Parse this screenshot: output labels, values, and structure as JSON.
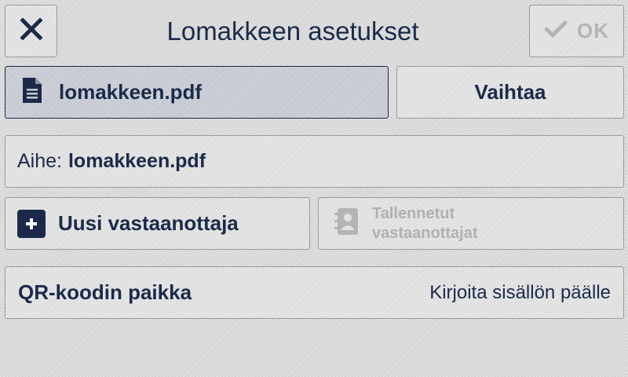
{
  "header": {
    "title": "Lomakkeen asetukset",
    "close_icon": "close-icon",
    "ok_label": "OK",
    "ok_icon": "checkmark-icon"
  },
  "file": {
    "name": "lomakkeen.pdf",
    "icon": "document-icon",
    "change_label": "Vaihtaa"
  },
  "subject": {
    "label": "Aihe:",
    "value": "lomakkeen.pdf"
  },
  "recipients": {
    "new_label": "Uusi vastaanottaja",
    "new_icon": "plus-icon",
    "saved_label": "Tallennetut vastaanottajat",
    "saved_icon": "address-book-icon"
  },
  "qr": {
    "label": "QR-koodin paikka",
    "value": "Kirjoita sisällön päälle"
  },
  "colors": {
    "primary": "#1b2a4a",
    "disabled": "#b4b4b4",
    "selected_bg": "#c8ccd4",
    "background": "#dcdcdc"
  }
}
